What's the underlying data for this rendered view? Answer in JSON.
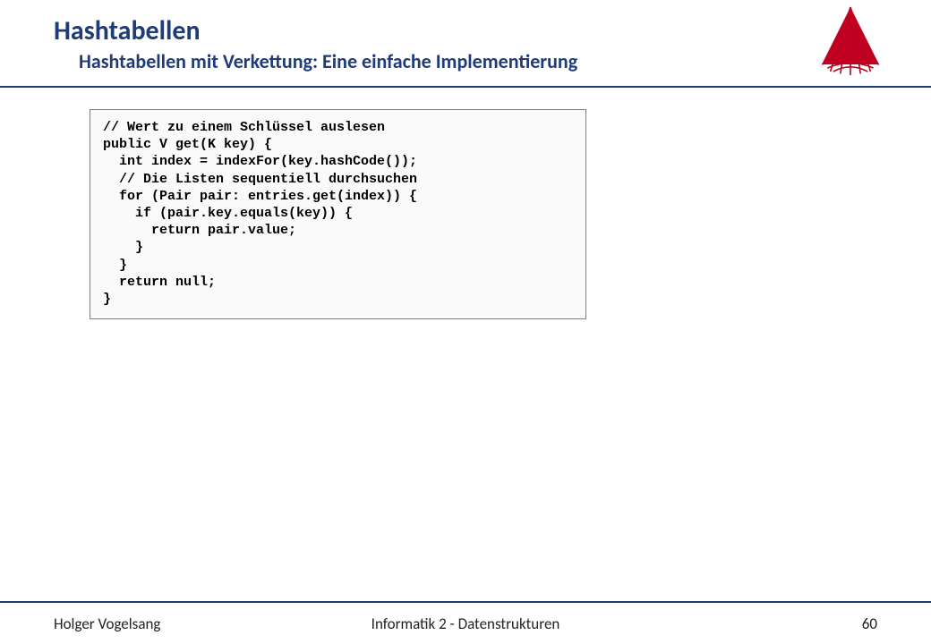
{
  "header": {
    "title": "Hashtabellen",
    "subtitle": "Hashtabellen mit Verkettung: Eine einfache Implementierung"
  },
  "code": {
    "text": "// Wert zu einem Schlüssel auslesen\npublic V get(K key) {\n  int index = indexFor(key.hashCode());\n  // Die Listen sequentiell durchsuchen\n  for (Pair pair: entries.get(index)) {\n    if (pair.key.equals(key)) {\n      return pair.value;\n    }\n  }\n  return null;\n}"
  },
  "footer": {
    "author": "Holger Vogelsang",
    "course": "Informatik 2 - Datenstrukturen",
    "page": "60"
  }
}
